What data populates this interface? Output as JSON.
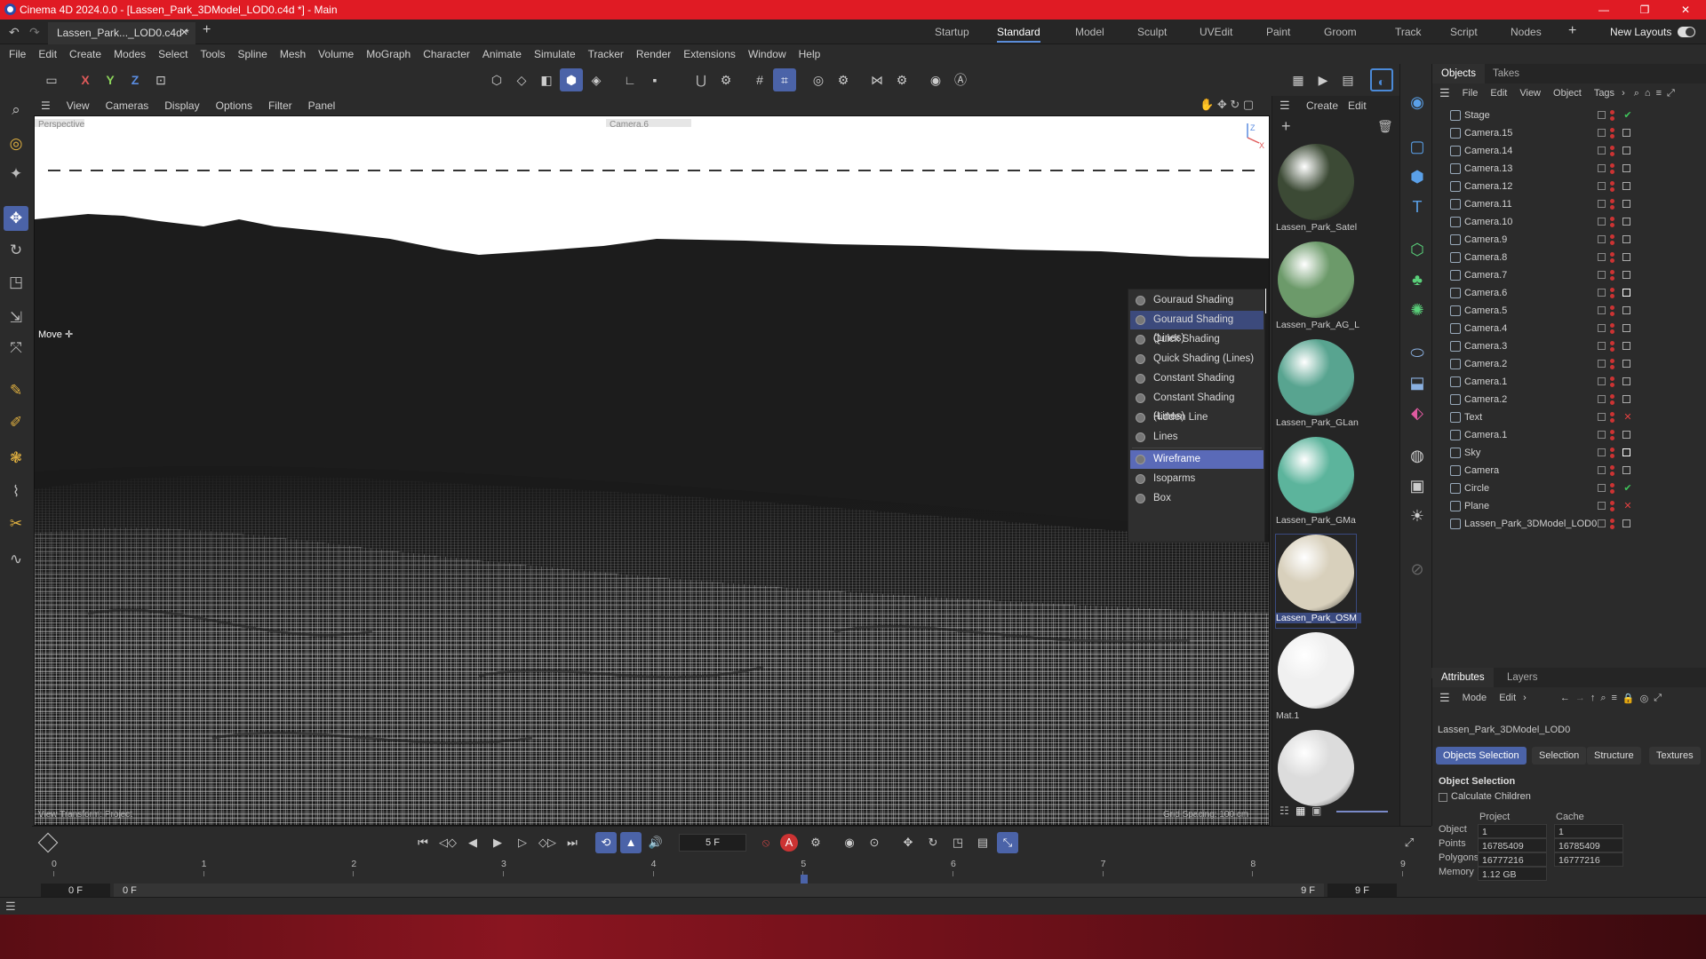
{
  "window": {
    "title": "Cinema 4D 2024.0.0 - [Lassen_Park_3DModel_LOD0.c4d *] - Main",
    "min": "—",
    "max": "❐",
    "close": "✕"
  },
  "tabs": {
    "doc_tab": "Lassen_Park..._LOD0.c4d *",
    "close": "✕",
    "add": "+",
    "layouts": [
      "Startup",
      "Standard",
      "Model",
      "Sculpt",
      "UVEdit",
      "Paint",
      "Groom",
      "Track",
      "Script",
      "Nodes"
    ],
    "active_layout": "Standard",
    "new_layouts": "New Layouts",
    "add_layout": "+"
  },
  "menu": [
    "File",
    "Edit",
    "Create",
    "Modes",
    "Select",
    "Tools",
    "Spline",
    "Mesh",
    "Volume",
    "MoGraph",
    "Character",
    "Animate",
    "Simulate",
    "Tracker",
    "Render",
    "Extensions",
    "Window",
    "Help"
  ],
  "axes": {
    "x": "X",
    "y": "Y",
    "z": "Z"
  },
  "viewport": {
    "menu": [
      "View",
      "Cameras",
      "Display",
      "Options",
      "Filter",
      "Panel"
    ],
    "tool_label": "Move",
    "top_left_label": "Perspective",
    "top_center_label": "Camera.6",
    "bottom_left": "View Transform: Project",
    "bottom_right": "Grid Spacing: 100 cm",
    "shading_options": [
      "Gouraud Shading",
      "Gouraud Shading (Lines)",
      "Quick Shading",
      "Quick Shading (Lines)",
      "Constant Shading",
      "Constant Shading (Lines)",
      "Hidden Line",
      "Lines",
      "Wireframe",
      "Isoparms",
      "Box"
    ],
    "shading_selected": "Gouraud Shading (Lines)",
    "shading_active": "Wireframe"
  },
  "materials": {
    "menu": [
      "Create",
      "Edit"
    ],
    "items": [
      {
        "name": "Lassen_Park_Satel",
        "color": "#3c4a35"
      },
      {
        "name": "Lassen_Park_AG_L",
        "color": "#6c9a6a"
      },
      {
        "name": "Lassen_Park_GLan",
        "color": "#58a490"
      },
      {
        "name": "Lassen_Park_GMa",
        "color": "#5cb49c"
      },
      {
        "name": "Lassen_Park_OSM",
        "color": "#d8d0bc"
      },
      {
        "name": "Mat.1",
        "color": "#f0f0f0"
      },
      {
        "name": "",
        "color": "#dcdcdc"
      }
    ],
    "selected": "Lassen_Park_OSM"
  },
  "objects": {
    "tabs": [
      "Objects",
      "Takes"
    ],
    "menu": [
      "File",
      "Edit",
      "View",
      "Object",
      "Tags"
    ],
    "rows": [
      {
        "name": "Stage",
        "tag": "✔",
        "tag_color": "#3fc35a"
      },
      {
        "name": "Camera.15",
        "tag": "",
        "tag_color": "#aaa"
      },
      {
        "name": "Camera.14",
        "tag": "",
        "tag_color": "#aaa"
      },
      {
        "name": "Camera.13",
        "tag": "",
        "tag_color": "#aaa"
      },
      {
        "name": "Camera.12",
        "tag": "",
        "tag_color": "#aaa"
      },
      {
        "name": "Camera.11",
        "tag": "",
        "tag_color": "#aaa"
      },
      {
        "name": "Camera.10",
        "tag": "",
        "tag_color": "#aaa"
      },
      {
        "name": "Camera.9",
        "tag": "",
        "tag_color": "#aaa"
      },
      {
        "name": "Camera.8",
        "tag": "",
        "tag_color": "#aaa"
      },
      {
        "name": "Camera.7",
        "tag": "",
        "tag_color": "#aaa"
      },
      {
        "name": "Camera.6",
        "tag": "",
        "tag_color": "#fff"
      },
      {
        "name": "Camera.5",
        "tag": "",
        "tag_color": "#aaa"
      },
      {
        "name": "Camera.4",
        "tag": "",
        "tag_color": "#aaa"
      },
      {
        "name": "Camera.3",
        "tag": "",
        "tag_color": "#aaa"
      },
      {
        "name": "Camera.2",
        "tag": "",
        "tag_color": "#aaa"
      },
      {
        "name": "Camera.1",
        "tag": "",
        "tag_color": "#aaa"
      },
      {
        "name": "Camera.2",
        "tag": "",
        "tag_color": "#aaa"
      },
      {
        "name": "Text",
        "tag": "✕",
        "tag_color": "#e04040"
      },
      {
        "name": "Camera.1",
        "tag": "",
        "tag_color": "#aaa"
      },
      {
        "name": "Sky",
        "tag": "",
        "tag_color": "#fff"
      },
      {
        "name": "Camera",
        "tag": "",
        "tag_color": "#aaa"
      },
      {
        "name": "Circle",
        "tag": "✔",
        "tag_color": "#3fc35a"
      },
      {
        "name": "Plane",
        "tag": "✕",
        "tag_color": "#e04040"
      },
      {
        "name": "Lassen_Park_3DModel_LOD0",
        "tag": "",
        "tag_color": "#aaa"
      }
    ]
  },
  "attributes": {
    "tabs": [
      "Attributes",
      "Layers"
    ],
    "menu": [
      "Mode",
      "Edit"
    ],
    "object_name": "Lassen_Park_3DModel_LOD0",
    "subtabs": [
      "Objects Selection",
      "Selection",
      "Structure",
      "Textures"
    ],
    "section": "Object Selection",
    "checkbox": "Calculate Children",
    "col_project": "Project",
    "col_cache": "Cache",
    "rows": [
      {
        "label": "Object",
        "project": "1",
        "cache": "1"
      },
      {
        "label": "Points",
        "project": "16785409",
        "cache": "16785409"
      },
      {
        "label": "Polygons",
        "project": "16777216",
        "cache": "16777216"
      },
      {
        "label": "Memory",
        "project": "1.12 GB",
        "cache": ""
      }
    ]
  },
  "timeline": {
    "current_frame": "5 F",
    "ticks": [
      "0",
      "1",
      "2",
      "3",
      "4",
      "5",
      "6",
      "7",
      "8",
      "9"
    ],
    "start_frame": "0 F",
    "range_start": "0 F",
    "range_end": "9 F",
    "end_frame": "9 F",
    "current_value": 5,
    "max_value": 9
  },
  "accent": "#4b63a8",
  "title_color": "#e01b24"
}
